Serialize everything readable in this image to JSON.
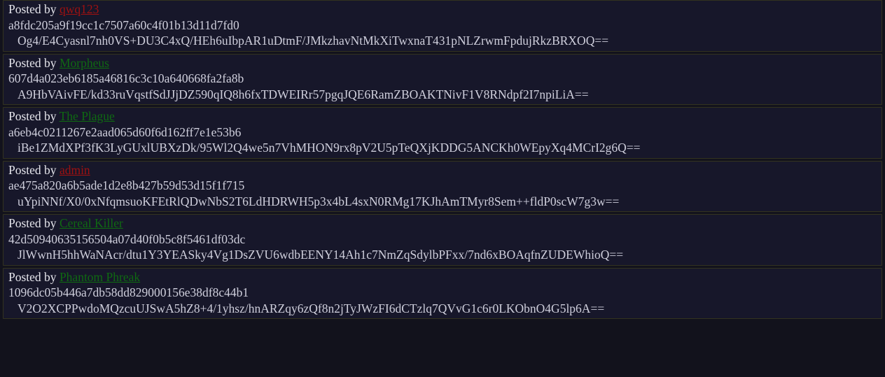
{
  "page": {
    "background_color": "#12121c",
    "card_color": "#17172a",
    "card_border_color": "#33331f",
    "text_color": "#cfcfdc",
    "link_red": "#9e1111",
    "link_green": "#0f6a12",
    "posted_by_label": "Posted by "
  },
  "posts": [
    {
      "author": "qwq123",
      "author_color": "red",
      "hash": "a8fdc205a9f19cc1c7507a60c4f01b13d11d7fd0",
      "signature": "Og4/E4Cyasnl7nh0VS+DU3C4xQ/HEh6uIbpAR1uDtmF/JMkzhavNtMkXiTwxnaT431pNLZrwmFpdujRkzBRXOQ=="
    },
    {
      "author": "Morpheus",
      "author_color": "green",
      "hash": "607d4a023eb6185a46816c3c10a640668fa2fa8b",
      "signature": "A9HbVAivFE/kd33ruVqstfSdJJjDZ590qIQ8h6fxTDWEIRr57pgqJQE6RamZBOAKTNivF1V8RNdpf2I7npiLiA=="
    },
    {
      "author": "The Plague",
      "author_color": "green",
      "hash": "a6eb4c0211267e2aad065d60f6d162ff7e1e53b6",
      "signature": "iBe1ZMdXPf3fK3LyGUxlUBXzDk/95Wl2Q4we5n7VhMHON9rx8pV2U5pTeQXjKDDG5ANCKh0WEpyXq4MCrI2g6Q=="
    },
    {
      "author": "admin",
      "author_color": "red",
      "hash": "ae475a820a6b5ade1d2e8b427b59d53d15f1f715",
      "signature": "uYpiNNf/X0/0xNfqmsuoKFEtRlQDwNbS2T6LdHDRWH5p3x4bL4sxN0RMg17KJhAmTMyr8Sem++fldP0scW7g3w=="
    },
    {
      "author": "Cereal Killer",
      "author_color": "green",
      "hash": "42d50940635156504a07d40f0b5c8f5461df03dc",
      "signature": "JlWwnH5hhWaNAcr/dtu1Y3YEASky4Vg1DsZVU6wdbEENY14Ah1c7NmZqSdylbPFxx/7nd6xBOAqfnZUDEWhioQ=="
    },
    {
      "author": "Phantom Phreak",
      "author_color": "green",
      "hash": "1096dc05b446a7db58dd829000156e38df8c44b1",
      "signature": "V2O2XCPPwdoMQzcuUJSwA5hZ8+4/1yhsz/hnARZqy6zQf8n2jTyJWzFI6dCTzlq7QVvG1c6r0LKObnO4G5lp6A=="
    }
  ]
}
